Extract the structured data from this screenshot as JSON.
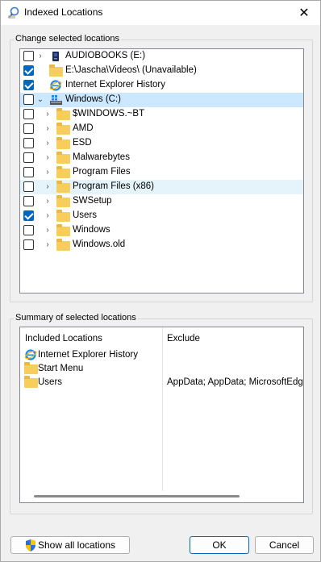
{
  "window": {
    "title": "Indexed Locations",
    "close_glyph": "✕"
  },
  "change_group": {
    "label": "Change selected locations",
    "items": [
      {
        "label": "AUDIOBOOKS (E:)",
        "checked": false,
        "expander": "›",
        "icon": "drive-icon"
      },
      {
        "label": "E:\\Jascha\\Videos\\ (Unavailable)",
        "checked": true,
        "expander": "",
        "icon": "folder-icon"
      },
      {
        "label": "Internet Explorer History",
        "checked": true,
        "expander": "",
        "icon": "ie-icon"
      },
      {
        "label": "Windows (C:)",
        "checked": false,
        "expander": "⌄",
        "icon": "system-drive-icon"
      },
      {
        "label": "$WINDOWS.~BT",
        "checked": false,
        "expander": "›",
        "icon": "folder-icon"
      },
      {
        "label": "AMD",
        "checked": false,
        "expander": "›",
        "icon": "folder-icon"
      },
      {
        "label": "ESD",
        "checked": false,
        "expander": "›",
        "icon": "folder-icon"
      },
      {
        "label": "Malwarebytes",
        "checked": false,
        "expander": "›",
        "icon": "folder-icon"
      },
      {
        "label": "Program Files",
        "checked": false,
        "expander": "›",
        "icon": "folder-icon"
      },
      {
        "label": "Program Files (x86)",
        "checked": false,
        "expander": "›",
        "icon": "folder-icon"
      },
      {
        "label": "SWSetup",
        "checked": false,
        "expander": "›",
        "icon": "folder-icon"
      },
      {
        "label": "Users",
        "checked": true,
        "expander": "›",
        "icon": "folder-icon"
      },
      {
        "label": "Windows",
        "checked": false,
        "expander": "›",
        "icon": "folder-icon"
      },
      {
        "label": "Windows.old",
        "checked": false,
        "expander": "›",
        "icon": "folder-icon"
      }
    ]
  },
  "summary_group": {
    "label": "Summary of selected locations",
    "col_included": "Included Locations",
    "col_exclude": "Exclude",
    "rows": [
      {
        "included": "Internet Explorer History",
        "exclude": "",
        "icon": "ie-icon"
      },
      {
        "included": "Start Menu",
        "exclude": "",
        "icon": "folder-icon"
      },
      {
        "included": "Users",
        "exclude": "AppData; AppData; MicrosoftEdgeB",
        "icon": "folder-icon"
      }
    ]
  },
  "buttons": {
    "show_all": "Show all locations",
    "ok": "OK",
    "cancel": "Cancel"
  },
  "colors": {
    "accent": "#0067c0",
    "folder": "#f7ce5c",
    "selection": "#cce8ff",
    "hover": "#e5f3fb"
  }
}
